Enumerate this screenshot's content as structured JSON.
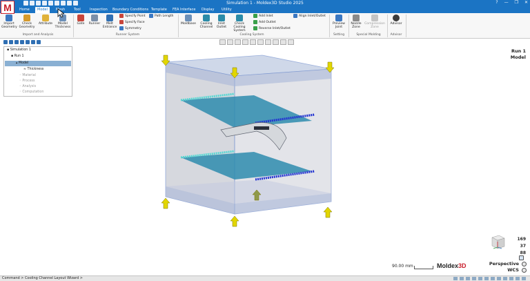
{
  "window": {
    "title": "Simulation 1 - Moldex3D Studio 2025",
    "controls": [
      "?",
      "—",
      "❐",
      "✕"
    ]
  },
  "tabs": [
    {
      "label": "Home"
    },
    {
      "label": "Model"
    },
    {
      "label": "Mesh"
    },
    {
      "label": "Tool"
    },
    {
      "label": "Inspection"
    },
    {
      "label": "Boundary Conditions"
    },
    {
      "label": "Template"
    },
    {
      "label": "FEA Interface"
    },
    {
      "label": "Display"
    },
    {
      "label": "Utility"
    }
  ],
  "ribbon": {
    "import_analysis": {
      "group": "Import and Analysis",
      "buttons": [
        "Import Geometry",
        "Check Geometry",
        "Attribute",
        "Model Thickness"
      ]
    },
    "runner_system": {
      "group": "Runner System",
      "buttons": [
        "Gate",
        "Runner",
        "Melt Entrance"
      ],
      "small": [
        "Specify Point",
        "Specify Face",
        "Symmetry",
        "Path Length"
      ]
    },
    "cooling_system": {
      "group": "Cooling System",
      "buttons": [
        "Moldbase",
        "Cooling Channel",
        "Inlet Outlet",
        "Check Cooling System"
      ],
      "small": [
        "Add Inlet",
        "Add Outlet",
        "Reverse Inlet/Outlet",
        "Align Inlet/Outlet"
      ]
    },
    "setting": {
      "group": "Setting",
      "buttons": [
        "Preview Joint"
      ]
    },
    "special_molding": {
      "group": "Special Molding",
      "buttons": [
        "Nozzle Zone",
        "Compression Zone"
      ]
    },
    "advisor": {
      "group": "Advisor",
      "buttons": [
        "Advisor"
      ]
    }
  },
  "tree": {
    "items": [
      {
        "label": "Simulation 1"
      },
      {
        "label": "Run 1"
      },
      {
        "label": "Model"
      },
      {
        "label": "Thickness"
      },
      {
        "label": "Material"
      },
      {
        "label": "Process"
      },
      {
        "label": "Analysis"
      },
      {
        "label": "Computation"
      }
    ]
  },
  "viewport": {
    "run_label": "Run 1",
    "model_label": "Model",
    "coords": [
      "169",
      "37",
      "88"
    ],
    "projection": "Perspective",
    "coordinate_system": "WCS",
    "scale_text": "90.00 mm",
    "brand_main": "Moldex",
    "brand_accent": "3D"
  },
  "status": {
    "command": "Command > Cooling Channel Layout Wizard >"
  },
  "colors": {
    "title_bar": "#1b74c4",
    "accent_red": "#c81e2b",
    "mold_blue": "#7f9fd4",
    "channel_teal": "#2b8ba8",
    "arrow_yellow": "#e2d600"
  }
}
